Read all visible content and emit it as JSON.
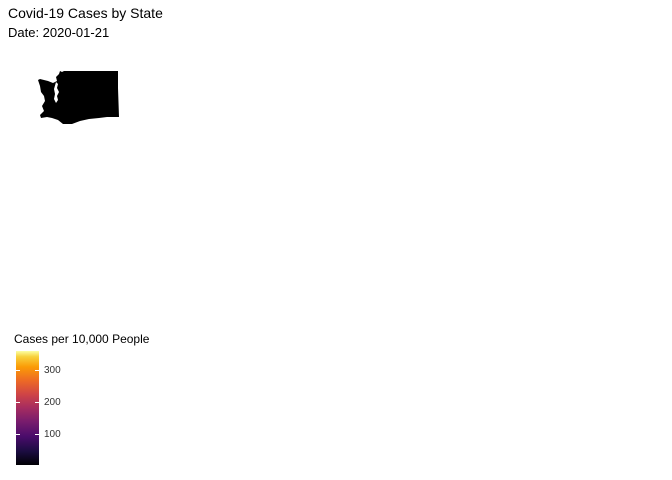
{
  "title": "Covid-19 Cases by State",
  "subtitle": "Date: 2020-01-21",
  "map": {
    "highlighted_state": "Washington",
    "fill_color": "#000000"
  },
  "legend": {
    "title": "Cases per 10,000 People",
    "ticks": [
      {
        "label": "300",
        "value": 300
      },
      {
        "label": "200",
        "value": 200
      },
      {
        "label": "100",
        "value": 100
      }
    ],
    "color_scale": "inferno",
    "range": [
      0,
      370
    ]
  }
}
